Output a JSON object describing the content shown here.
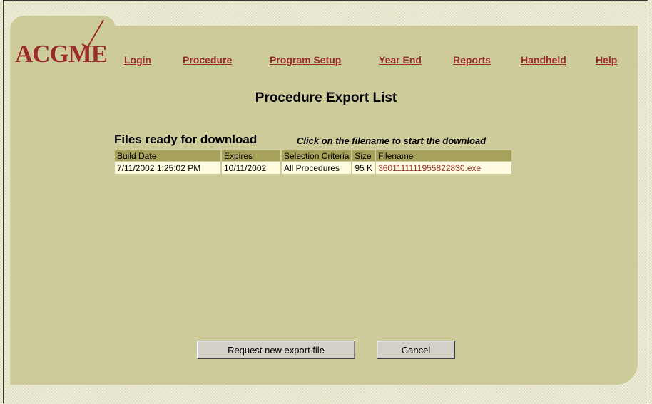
{
  "brand": {
    "logo": "ACGME"
  },
  "nav": {
    "login": "Login",
    "procedure": "Procedure",
    "program_setup": "Program Setup",
    "year_end": "Year End",
    "reports": "Reports",
    "handheld": "Handheld",
    "help": "Help"
  },
  "page": {
    "title": "Procedure Export List",
    "section_heading": "Files ready for download",
    "instruction": "Click on the filename to start the download"
  },
  "table": {
    "headers": [
      "Build Date",
      "Expires",
      "Selection Criteria",
      "Size",
      "Filename"
    ],
    "rows": [
      [
        "7/11/2002 1:25:02 PM",
        "10/11/2002",
        "All Procedures",
        "95 K",
        "3601111111955822830.exe"
      ]
    ]
  },
  "buttons": {
    "request_new": "Request new export file",
    "cancel": "Cancel"
  },
  "colors": {
    "panel": "#cdcb9a",
    "header_cell": "#a7a25a",
    "data_cell": "#fffbe0",
    "link": "#9b2c2c"
  }
}
